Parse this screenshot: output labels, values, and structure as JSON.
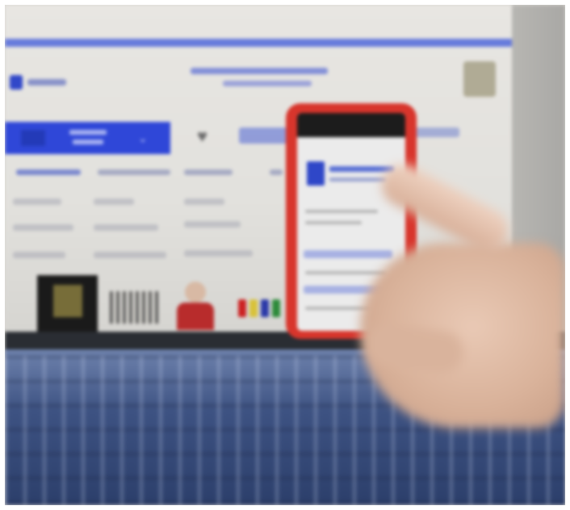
{
  "scene": {
    "subject": "blurred photo",
    "colors": {
      "brand_blue": "#3148c9",
      "phone_case_red": "#d8352c",
      "keyboard_blue": "#3d5282",
      "skin": "#d9b29a"
    },
    "icons": {
      "heart": "heart-icon",
      "chevron": "chevron-down-icon"
    }
  }
}
